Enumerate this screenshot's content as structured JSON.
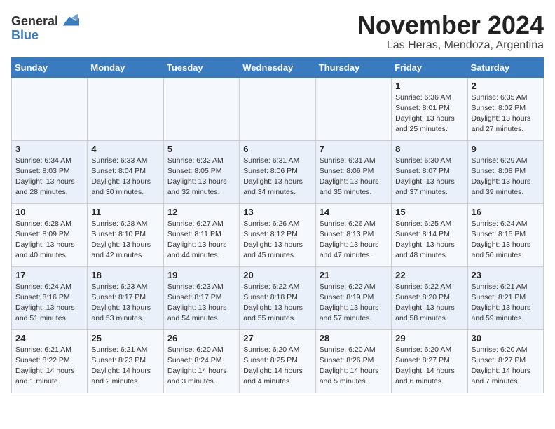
{
  "header": {
    "logo_general": "General",
    "logo_blue": "Blue",
    "month": "November 2024",
    "location": "Las Heras, Mendoza, Argentina"
  },
  "weekdays": [
    "Sunday",
    "Monday",
    "Tuesday",
    "Wednesday",
    "Thursday",
    "Friday",
    "Saturday"
  ],
  "weeks": [
    [
      {
        "day": "",
        "info": ""
      },
      {
        "day": "",
        "info": ""
      },
      {
        "day": "",
        "info": ""
      },
      {
        "day": "",
        "info": ""
      },
      {
        "day": "",
        "info": ""
      },
      {
        "day": "1",
        "info": "Sunrise: 6:36 AM\nSunset: 8:01 PM\nDaylight: 13 hours and 25 minutes."
      },
      {
        "day": "2",
        "info": "Sunrise: 6:35 AM\nSunset: 8:02 PM\nDaylight: 13 hours and 27 minutes."
      }
    ],
    [
      {
        "day": "3",
        "info": "Sunrise: 6:34 AM\nSunset: 8:03 PM\nDaylight: 13 hours and 28 minutes."
      },
      {
        "day": "4",
        "info": "Sunrise: 6:33 AM\nSunset: 8:04 PM\nDaylight: 13 hours and 30 minutes."
      },
      {
        "day": "5",
        "info": "Sunrise: 6:32 AM\nSunset: 8:05 PM\nDaylight: 13 hours and 32 minutes."
      },
      {
        "day": "6",
        "info": "Sunrise: 6:31 AM\nSunset: 8:06 PM\nDaylight: 13 hours and 34 minutes."
      },
      {
        "day": "7",
        "info": "Sunrise: 6:31 AM\nSunset: 8:06 PM\nDaylight: 13 hours and 35 minutes."
      },
      {
        "day": "8",
        "info": "Sunrise: 6:30 AM\nSunset: 8:07 PM\nDaylight: 13 hours and 37 minutes."
      },
      {
        "day": "9",
        "info": "Sunrise: 6:29 AM\nSunset: 8:08 PM\nDaylight: 13 hours and 39 minutes."
      }
    ],
    [
      {
        "day": "10",
        "info": "Sunrise: 6:28 AM\nSunset: 8:09 PM\nDaylight: 13 hours and 40 minutes."
      },
      {
        "day": "11",
        "info": "Sunrise: 6:28 AM\nSunset: 8:10 PM\nDaylight: 13 hours and 42 minutes."
      },
      {
        "day": "12",
        "info": "Sunrise: 6:27 AM\nSunset: 8:11 PM\nDaylight: 13 hours and 44 minutes."
      },
      {
        "day": "13",
        "info": "Sunrise: 6:26 AM\nSunset: 8:12 PM\nDaylight: 13 hours and 45 minutes."
      },
      {
        "day": "14",
        "info": "Sunrise: 6:26 AM\nSunset: 8:13 PM\nDaylight: 13 hours and 47 minutes."
      },
      {
        "day": "15",
        "info": "Sunrise: 6:25 AM\nSunset: 8:14 PM\nDaylight: 13 hours and 48 minutes."
      },
      {
        "day": "16",
        "info": "Sunrise: 6:24 AM\nSunset: 8:15 PM\nDaylight: 13 hours and 50 minutes."
      }
    ],
    [
      {
        "day": "17",
        "info": "Sunrise: 6:24 AM\nSunset: 8:16 PM\nDaylight: 13 hours and 51 minutes."
      },
      {
        "day": "18",
        "info": "Sunrise: 6:23 AM\nSunset: 8:17 PM\nDaylight: 13 hours and 53 minutes."
      },
      {
        "day": "19",
        "info": "Sunrise: 6:23 AM\nSunset: 8:17 PM\nDaylight: 13 hours and 54 minutes."
      },
      {
        "day": "20",
        "info": "Sunrise: 6:22 AM\nSunset: 8:18 PM\nDaylight: 13 hours and 55 minutes."
      },
      {
        "day": "21",
        "info": "Sunrise: 6:22 AM\nSunset: 8:19 PM\nDaylight: 13 hours and 57 minutes."
      },
      {
        "day": "22",
        "info": "Sunrise: 6:22 AM\nSunset: 8:20 PM\nDaylight: 13 hours and 58 minutes."
      },
      {
        "day": "23",
        "info": "Sunrise: 6:21 AM\nSunset: 8:21 PM\nDaylight: 13 hours and 59 minutes."
      }
    ],
    [
      {
        "day": "24",
        "info": "Sunrise: 6:21 AM\nSunset: 8:22 PM\nDaylight: 14 hours and 1 minute."
      },
      {
        "day": "25",
        "info": "Sunrise: 6:21 AM\nSunset: 8:23 PM\nDaylight: 14 hours and 2 minutes."
      },
      {
        "day": "26",
        "info": "Sunrise: 6:20 AM\nSunset: 8:24 PM\nDaylight: 14 hours and 3 minutes."
      },
      {
        "day": "27",
        "info": "Sunrise: 6:20 AM\nSunset: 8:25 PM\nDaylight: 14 hours and 4 minutes."
      },
      {
        "day": "28",
        "info": "Sunrise: 6:20 AM\nSunset: 8:26 PM\nDaylight: 14 hours and 5 minutes."
      },
      {
        "day": "29",
        "info": "Sunrise: 6:20 AM\nSunset: 8:27 PM\nDaylight: 14 hours and 6 minutes."
      },
      {
        "day": "30",
        "info": "Sunrise: 6:20 AM\nSunset: 8:27 PM\nDaylight: 14 hours and 7 minutes."
      }
    ]
  ]
}
